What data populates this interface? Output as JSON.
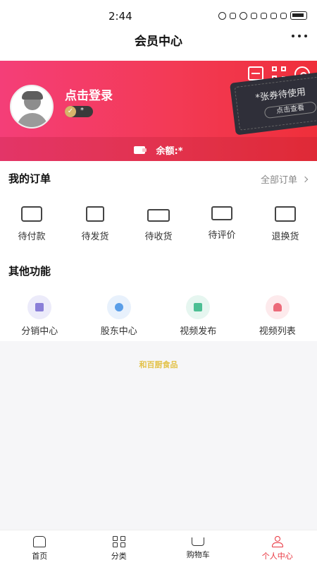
{
  "status_bar": {
    "time": "2:44"
  },
  "nav": {
    "title": "会员中心"
  },
  "profile": {
    "login_text": "点击登录",
    "level_text": "*",
    "coupon_text": "*张券待使用",
    "coupon_button": "点击查看",
    "balance_text": "余额:*"
  },
  "orders": {
    "title": "我的订单",
    "all_link": "全部订单",
    "items": [
      {
        "label": "待付款",
        "icon": "wallet-icon"
      },
      {
        "label": "待发货",
        "icon": "package-icon"
      },
      {
        "label": "待收货",
        "icon": "truck-icon"
      },
      {
        "label": "待评价",
        "icon": "comment-icon"
      },
      {
        "label": "退换货",
        "icon": "return-icon"
      }
    ]
  },
  "functions": {
    "title": "其他功能",
    "items": [
      {
        "label": "分销中心",
        "icon": "distribution-icon",
        "bg": "#ecebfa",
        "fg": "#8a7fd8"
      },
      {
        "label": "股东中心",
        "icon": "database-icon",
        "bg": "#e8f1fc",
        "fg": "#5a9ee8"
      },
      {
        "label": "视频发布",
        "icon": "video-publish-icon",
        "bg": "#e6f6f0",
        "fg": "#4dbf94"
      },
      {
        "label": "视频列表",
        "icon": "video-list-icon",
        "bg": "#fdeaec",
        "fg": "#ec6b7a"
      }
    ]
  },
  "footer": {
    "brand": "和百厨食品"
  },
  "tabbar": {
    "items": [
      {
        "label": "首页",
        "icon": "home-icon",
        "active": false
      },
      {
        "label": "分类",
        "icon": "category-icon",
        "active": false
      },
      {
        "label": "购物车",
        "icon": "cart-icon",
        "active": false
      },
      {
        "label": "个人中心",
        "icon": "user-icon",
        "active": true
      }
    ]
  },
  "colors": {
    "accent": "#e8323c",
    "banner_start": "#f43e78",
    "banner_end": "#ef2f3a",
    "brand_text": "#e3c24a"
  }
}
